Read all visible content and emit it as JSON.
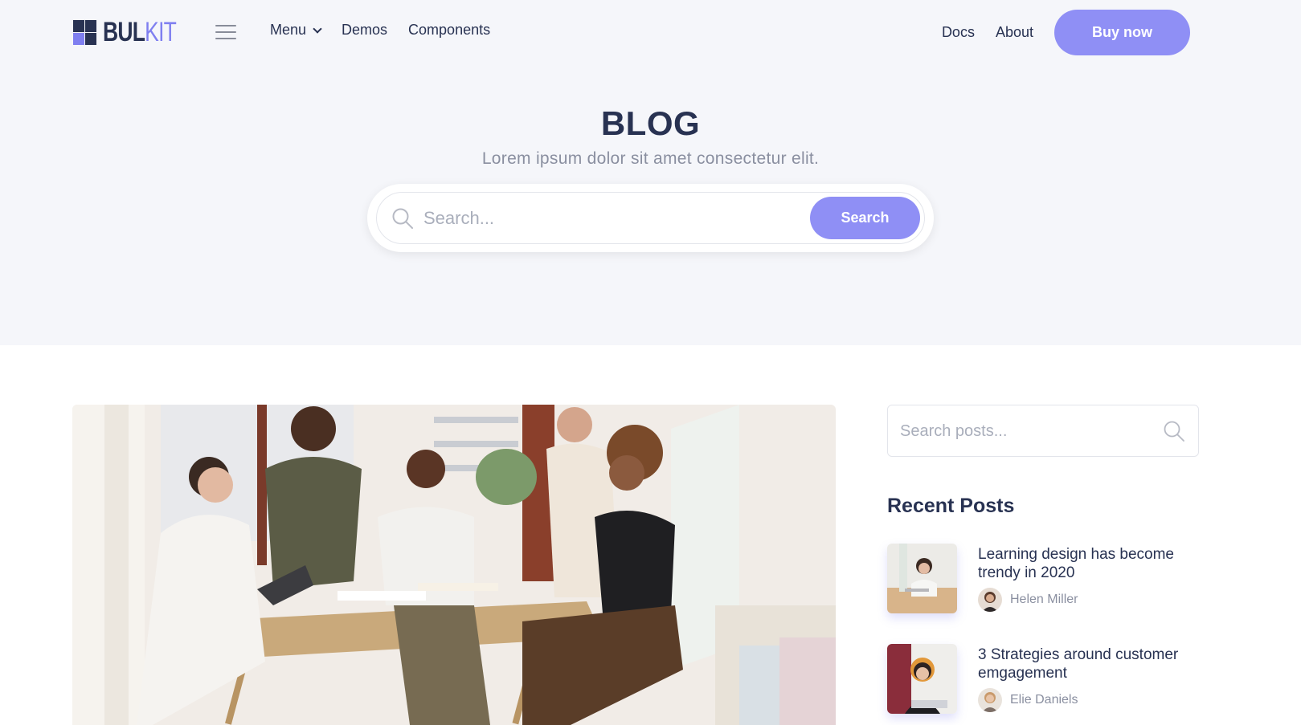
{
  "brand": {
    "name_part1": "BUL",
    "name_part2": "KIT"
  },
  "nav": {
    "menu_label": "Menu",
    "demos_label": "Demos",
    "components_label": "Components",
    "docs_label": "Docs",
    "about_label": "About",
    "buy_label": "Buy now"
  },
  "hero": {
    "title": "BLOG",
    "subtitle": "Lorem ipsum dolor sit amet consectetur elit.",
    "search_placeholder": "Search...",
    "search_button": "Search"
  },
  "sidebar": {
    "search_placeholder": "Search posts...",
    "recent_title": "Recent Posts",
    "posts": [
      {
        "title": "Learning design has become trendy in 2020",
        "author": "Helen Miller"
      },
      {
        "title": "3 Strategies around customer emgagement",
        "author": "Elie Daniels"
      }
    ]
  },
  "colors": {
    "accent": "#8f8ff5",
    "dark": "#283252",
    "muted": "#8a8fa0",
    "hero_bg": "#f5f6fa"
  },
  "icons": [
    "hamburger-icon",
    "chevron-down-icon",
    "search-icon"
  ]
}
